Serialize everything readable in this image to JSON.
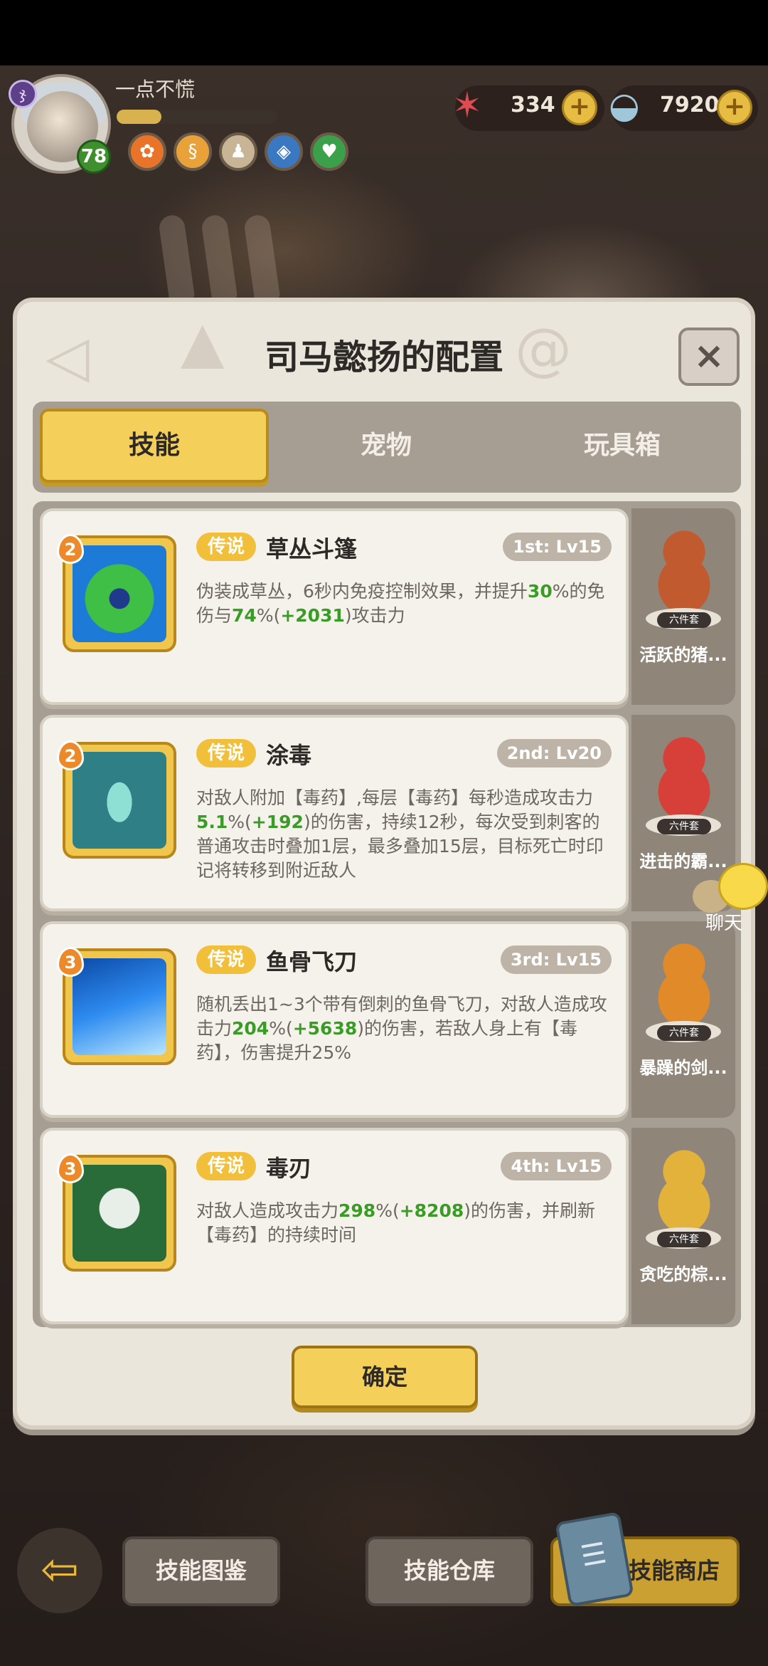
{
  "player": {
    "name": "一点不慌",
    "level": "78",
    "class_glyph": "ჯ",
    "xp_fraction": 0.28,
    "buffs": [
      {
        "icon": "paw-orange-icon",
        "glyph": "✿",
        "color": "#e8742a"
      },
      {
        "icon": "coin-rune-icon",
        "glyph": "§",
        "color": "#e9a23a"
      },
      {
        "icon": "bell-icon",
        "glyph": "♟",
        "color": "#c8b596"
      },
      {
        "icon": "shield-blue-icon",
        "glyph": "◈",
        "color": "#3a78c2"
      },
      {
        "icon": "heart-green-icon",
        "glyph": "♥",
        "color": "#3aa04a"
      }
    ]
  },
  "currency": {
    "starfish": {
      "icon": "starfish-icon",
      "value": "334"
    },
    "shell": {
      "icon": "shell-icon",
      "value": "7920"
    },
    "plus_label": "+"
  },
  "panel": {
    "title": "司马懿扬的配置",
    "close_label": "×",
    "tabs": [
      {
        "label": "技能",
        "active": true
      },
      {
        "label": "宠物",
        "active": false
      },
      {
        "label": "玩具箱",
        "active": false
      }
    ],
    "confirm_label": "确定"
  },
  "skills": [
    {
      "rarity": "传说",
      "name": "草丛斗篷",
      "slot": "1st: Lv15",
      "star": "2",
      "icon": "bush-cloak-icon",
      "desc_parts": [
        {
          "t": "伪装成草丛，6秒内免疫控制效果，并提升"
        },
        {
          "t": "30",
          "g": true
        },
        {
          "t": "%的免伤与"
        },
        {
          "t": "74",
          "g": true
        },
        {
          "t": "%("
        },
        {
          "t": "+2031",
          "g": true
        },
        {
          "t": ")攻击力"
        }
      ],
      "pet": {
        "name": "活跃的猪...",
        "set": "六件套",
        "icon": "boar-pet-icon"
      }
    },
    {
      "rarity": "传说",
      "name": "涂毒",
      "slot": "2nd: Lv20",
      "star": "2",
      "icon": "poison-drop-icon",
      "desc_parts": [
        {
          "t": "对敌人附加【毒药】,每层【毒药】每秒造成攻击力"
        },
        {
          "t": "5.1",
          "g": true
        },
        {
          "t": "%("
        },
        {
          "t": "+192",
          "g": true
        },
        {
          "t": ")的伤害，持续12秒，每次受到刺客的普通攻击时叠加1层，最多叠加15层，目标死亡时印记将转移到附近敌人"
        }
      ],
      "pet": {
        "name": "进击的霸...",
        "set": "六件套",
        "icon": "dino-pet-icon"
      }
    },
    {
      "rarity": "传说",
      "name": "鱼骨飞刀",
      "slot": "3rd: Lv15",
      "star": "3",
      "icon": "fishbone-knife-icon",
      "desc_parts": [
        {
          "t": "随机丢出1~3个带有倒刺的鱼骨飞刀，对敌人造成攻击力"
        },
        {
          "t": "204",
          "g": true
        },
        {
          "t": "%("
        },
        {
          "t": "+5638",
          "g": true
        },
        {
          "t": ")的伤害，若敌人身上有【毒药】，伤害提升25%"
        }
      ],
      "pet": {
        "name": "暴躁的剑...",
        "set": "六件套",
        "icon": "cat-warrior-pet-icon"
      }
    },
    {
      "rarity": "传说",
      "name": "毒刃",
      "slot": "4th: Lv15",
      "star": "3",
      "icon": "poison-skull-icon",
      "desc_parts": [
        {
          "t": "对敌人造成攻击力"
        },
        {
          "t": "298",
          "g": true
        },
        {
          "t": "%("
        },
        {
          "t": "+8208",
          "g": true
        },
        {
          "t": ")的伤害，并刷新【毒药】的持续时间"
        }
      ],
      "pet": {
        "name": "贪吃的棕...",
        "set": "六件套",
        "icon": "bee-bear-pet-icon"
      }
    }
  ],
  "chat": {
    "label": "聊天"
  },
  "bottom": {
    "back_label": "⇦",
    "codex_label": "技能图鉴",
    "storage_label": "技能仓库",
    "shop_label": "技能商店"
  }
}
